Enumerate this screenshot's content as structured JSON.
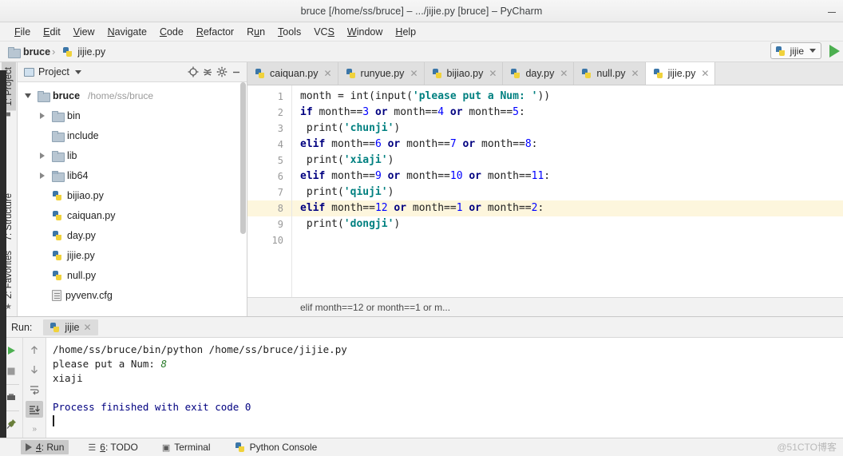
{
  "window": {
    "title": "bruce [/home/ss/bruce] – .../jijie.py [bruce] – PyCharm",
    "minimize_icon": "minimize-icon"
  },
  "menubar": {
    "items": [
      {
        "label": "File",
        "accel": "F"
      },
      {
        "label": "Edit",
        "accel": "E"
      },
      {
        "label": "View",
        "accel": "V"
      },
      {
        "label": "Navigate",
        "accel": "N"
      },
      {
        "label": "Code",
        "accel": "C"
      },
      {
        "label": "Refactor",
        "accel": "R"
      },
      {
        "label": "Run",
        "accel": "u"
      },
      {
        "label": "Tools",
        "accel": "T"
      },
      {
        "label": "VCS",
        "accel": "S"
      },
      {
        "label": "Window",
        "accel": "W"
      },
      {
        "label": "Help",
        "accel": "H"
      }
    ]
  },
  "navbar": {
    "crumbs": [
      {
        "label": "bruce",
        "icon": "folder-icon"
      },
      {
        "label": "jijie.py",
        "icon": "python-file-icon"
      }
    ],
    "run_config": {
      "label": "jijie",
      "icon": "python-file-icon",
      "caret": "chevron-down-icon"
    },
    "run_button": "run-button"
  },
  "left_strip": {
    "top": [
      {
        "label": "1: Project",
        "accel": "1",
        "active": true
      }
    ],
    "bottom": [
      {
        "label": "7: Structure",
        "accel": "7",
        "active": false
      },
      {
        "label": "2: Favorites",
        "accel": "2",
        "active": false
      }
    ]
  },
  "project_panel": {
    "title": "Project",
    "caret": "chevron-down-icon",
    "toolbar": [
      "locate-icon",
      "collapse-all-icon",
      "gear-icon",
      "minimize-icon"
    ],
    "tree": [
      {
        "label": "bruce",
        "path": "/home/ss/bruce",
        "icon": "folder-icon",
        "indent": 0,
        "twisty": "down",
        "bold": true
      },
      {
        "label": "bin",
        "path": "",
        "icon": "folder-icon",
        "indent": 1,
        "twisty": "right",
        "bold": false
      },
      {
        "label": "include",
        "path": "",
        "icon": "folder-icon",
        "indent": 1,
        "twisty": "none",
        "bold": false
      },
      {
        "label": "lib",
        "path": "",
        "icon": "folder-icon",
        "indent": 1,
        "twisty": "right",
        "bold": false
      },
      {
        "label": "lib64",
        "path": "",
        "icon": "folder-link-icon",
        "indent": 1,
        "twisty": "right",
        "bold": false
      },
      {
        "label": "bijiao.py",
        "path": "",
        "icon": "python-file-icon",
        "indent": 1,
        "twisty": "none",
        "bold": false
      },
      {
        "label": "caiquan.py",
        "path": "",
        "icon": "python-file-icon",
        "indent": 1,
        "twisty": "none",
        "bold": false
      },
      {
        "label": "day.py",
        "path": "",
        "icon": "python-file-icon",
        "indent": 1,
        "twisty": "none",
        "bold": false
      },
      {
        "label": "jijie.py",
        "path": "",
        "icon": "python-file-icon",
        "indent": 1,
        "twisty": "none",
        "bold": false
      },
      {
        "label": "null.py",
        "path": "",
        "icon": "python-file-icon",
        "indent": 1,
        "twisty": "none",
        "bold": false
      },
      {
        "label": "pyvenv.cfg",
        "path": "",
        "icon": "config-file-icon",
        "indent": 1,
        "twisty": "none",
        "bold": false
      }
    ]
  },
  "editor": {
    "tabs": [
      {
        "label": "caiquan.py",
        "active": false,
        "close": "close-icon"
      },
      {
        "label": "runyue.py",
        "active": false,
        "close": "close-icon"
      },
      {
        "label": "bijiao.py",
        "active": false,
        "close": "close-icon"
      },
      {
        "label": "day.py",
        "active": false,
        "close": "close-icon"
      },
      {
        "label": "null.py",
        "active": false,
        "close": "close-icon"
      },
      {
        "label": "jijie.py",
        "active": true,
        "close": "close-icon"
      }
    ],
    "line_numbers": [
      "1",
      "2",
      "3",
      "4",
      "5",
      "6",
      "7",
      "8",
      "9",
      "10"
    ],
    "current_line": 8,
    "code_lines": [
      [
        {
          "t": "month = ",
          "c": "fn"
        },
        {
          "t": "int",
          "c": "fn"
        },
        {
          "t": "(",
          "c": "fn"
        },
        {
          "t": "input",
          "c": "fn"
        },
        {
          "t": "(",
          "c": "fn"
        },
        {
          "t": "'please put a Num: '",
          "c": "str"
        },
        {
          "t": "))",
          "c": "fn"
        }
      ],
      [
        {
          "t": "if",
          "c": "kw"
        },
        {
          "t": " month==",
          "c": "fn"
        },
        {
          "t": "3",
          "c": "num"
        },
        {
          "t": " ",
          "c": "fn"
        },
        {
          "t": "or",
          "c": "kw"
        },
        {
          "t": " month==",
          "c": "fn"
        },
        {
          "t": "4",
          "c": "num"
        },
        {
          "t": " ",
          "c": "fn"
        },
        {
          "t": "or",
          "c": "kw"
        },
        {
          "t": " month==",
          "c": "fn"
        },
        {
          "t": "5",
          "c": "num"
        },
        {
          "t": ":",
          "c": "fn"
        }
      ],
      [
        {
          "t": " print(",
          "c": "fn"
        },
        {
          "t": "'chunji'",
          "c": "str"
        },
        {
          "t": ")",
          "c": "fn"
        }
      ],
      [
        {
          "t": "elif",
          "c": "kw"
        },
        {
          "t": " month==",
          "c": "fn"
        },
        {
          "t": "6",
          "c": "num"
        },
        {
          "t": " ",
          "c": "fn"
        },
        {
          "t": "or",
          "c": "kw"
        },
        {
          "t": " month==",
          "c": "fn"
        },
        {
          "t": "7",
          "c": "num"
        },
        {
          "t": " ",
          "c": "fn"
        },
        {
          "t": "or",
          "c": "kw"
        },
        {
          "t": " month==",
          "c": "fn"
        },
        {
          "t": "8",
          "c": "num"
        },
        {
          "t": ":",
          "c": "fn"
        }
      ],
      [
        {
          "t": " print(",
          "c": "fn"
        },
        {
          "t": "'xiaji'",
          "c": "str"
        },
        {
          "t": ")",
          "c": "fn"
        }
      ],
      [
        {
          "t": "elif",
          "c": "kw"
        },
        {
          "t": " month==",
          "c": "fn"
        },
        {
          "t": "9",
          "c": "num"
        },
        {
          "t": " ",
          "c": "fn"
        },
        {
          "t": "or",
          "c": "kw"
        },
        {
          "t": " month==",
          "c": "fn"
        },
        {
          "t": "10",
          "c": "num"
        },
        {
          "t": " ",
          "c": "fn"
        },
        {
          "t": "or",
          "c": "kw"
        },
        {
          "t": " month==",
          "c": "fn"
        },
        {
          "t": "11",
          "c": "num"
        },
        {
          "t": ":",
          "c": "fn"
        }
      ],
      [
        {
          "t": " print(",
          "c": "fn"
        },
        {
          "t": "'qiuji'",
          "c": "str"
        },
        {
          "t": ")",
          "c": "fn"
        }
      ],
      [
        {
          "t": "elif",
          "c": "kw"
        },
        {
          "t": " month==",
          "c": "fn"
        },
        {
          "t": "12",
          "c": "num"
        },
        {
          "t": " ",
          "c": "fn"
        },
        {
          "t": "or",
          "c": "kw"
        },
        {
          "t": " month==",
          "c": "fn"
        },
        {
          "t": "1",
          "c": "num"
        },
        {
          "t": " ",
          "c": "fn"
        },
        {
          "t": "or",
          "c": "kw"
        },
        {
          "t": " month==",
          "c": "fn"
        },
        {
          "t": "2",
          "c": "num"
        },
        {
          "t": ":",
          "c": "fn"
        }
      ],
      [
        {
          "t": " print(",
          "c": "fn"
        },
        {
          "t": "'dongji'",
          "c": "str"
        },
        {
          "t": ")",
          "c": "fn"
        }
      ],
      []
    ],
    "breadcrumb": "elif month==12 or month==1 or m..."
  },
  "run_window": {
    "label": "Run:",
    "tab": {
      "label": "jijie",
      "icon": "python-file-icon",
      "close": "close-icon"
    },
    "tools_left": [
      "rerun-icon",
      "stop-icon",
      "print-icon",
      "pin-icon"
    ],
    "tools_right": [
      "up-arrow-icon",
      "down-arrow-icon",
      "soft-wrap-icon",
      "scroll-to-end-icon",
      "expand-icon"
    ],
    "console": [
      {
        "segments": [
          {
            "t": "/home/ss/bruce/bin/python /home/ss/bruce/jijie.py",
            "c": ""
          }
        ]
      },
      {
        "segments": [
          {
            "t": "please put a Num: ",
            "c": ""
          },
          {
            "t": "8",
            "c": "co-in"
          }
        ]
      },
      {
        "segments": [
          {
            "t": "xiaji",
            "c": ""
          }
        ]
      },
      {
        "segments": [
          {
            "t": "",
            "c": ""
          }
        ]
      },
      {
        "segments": [
          {
            "t": "Process finished with exit code 0",
            "c": "co-done"
          }
        ]
      }
    ]
  },
  "statusbar": {
    "items": [
      {
        "label": "4: Run",
        "accel": "4",
        "icon": "play-icon",
        "active": true
      },
      {
        "label": "6: TODO",
        "accel": "6",
        "icon": "todo-icon",
        "active": false
      },
      {
        "label": "Terminal",
        "accel": "",
        "icon": "terminal-icon",
        "active": false
      },
      {
        "label": "Python Console",
        "accel": "",
        "icon": "python-icon",
        "active": false
      }
    ],
    "watermark": "@51CTO博客"
  },
  "colors": {
    "keyword": "#000080",
    "string": "#008080",
    "number": "#0000ff",
    "current_line": "#fdf6dd",
    "accent_green": "#4caf50",
    "panel_bg": "#f2f2f2"
  }
}
